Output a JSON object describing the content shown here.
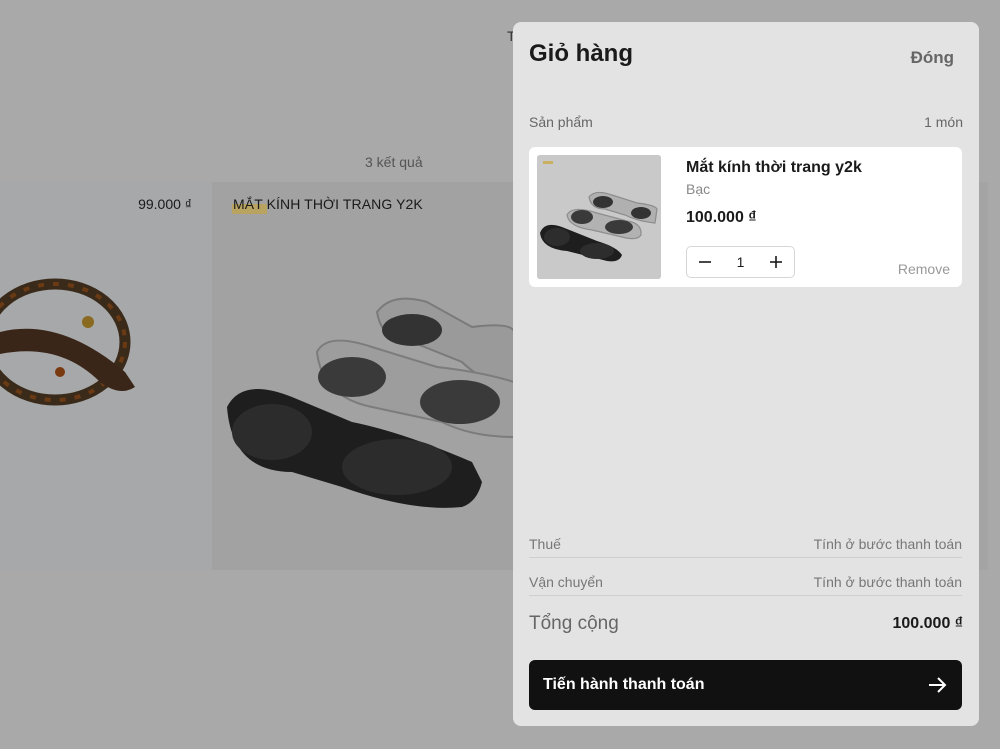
{
  "background": {
    "header_fragment": "T",
    "result_count": "3 kết quả",
    "product_1_price": "99.000 ₫",
    "product_2_name": "MẮT KÍNH THỜI TRANG Y2K"
  },
  "cart": {
    "title": "Giỏ hàng",
    "close_label": "Đóng",
    "section_label": "Sản phẩm",
    "item_count": "1 món",
    "items": [
      {
        "name": "Mắt kính thời trang y2k",
        "variant": "Bạc",
        "price": "100.000 ₫",
        "quantity": "1",
        "remove_label": "Remove"
      }
    ],
    "tax_label": "Thuế",
    "tax_value": "Tính ở bước thanh toán",
    "shipping_label": "Vận chuyển",
    "shipping_value": "Tính ở bước thanh toán",
    "total_label": "Tổng cộng",
    "total_value": "100.000 ₫",
    "checkout_label": "Tiến hành thanh toán"
  },
  "icons": {
    "minus": "minus-icon",
    "plus": "plus-icon",
    "arrow": "arrow-right-icon"
  },
  "colors": {
    "overlay": "#a9a9a9",
    "drawer": "#e3e3e3",
    "button": "#111111"
  }
}
